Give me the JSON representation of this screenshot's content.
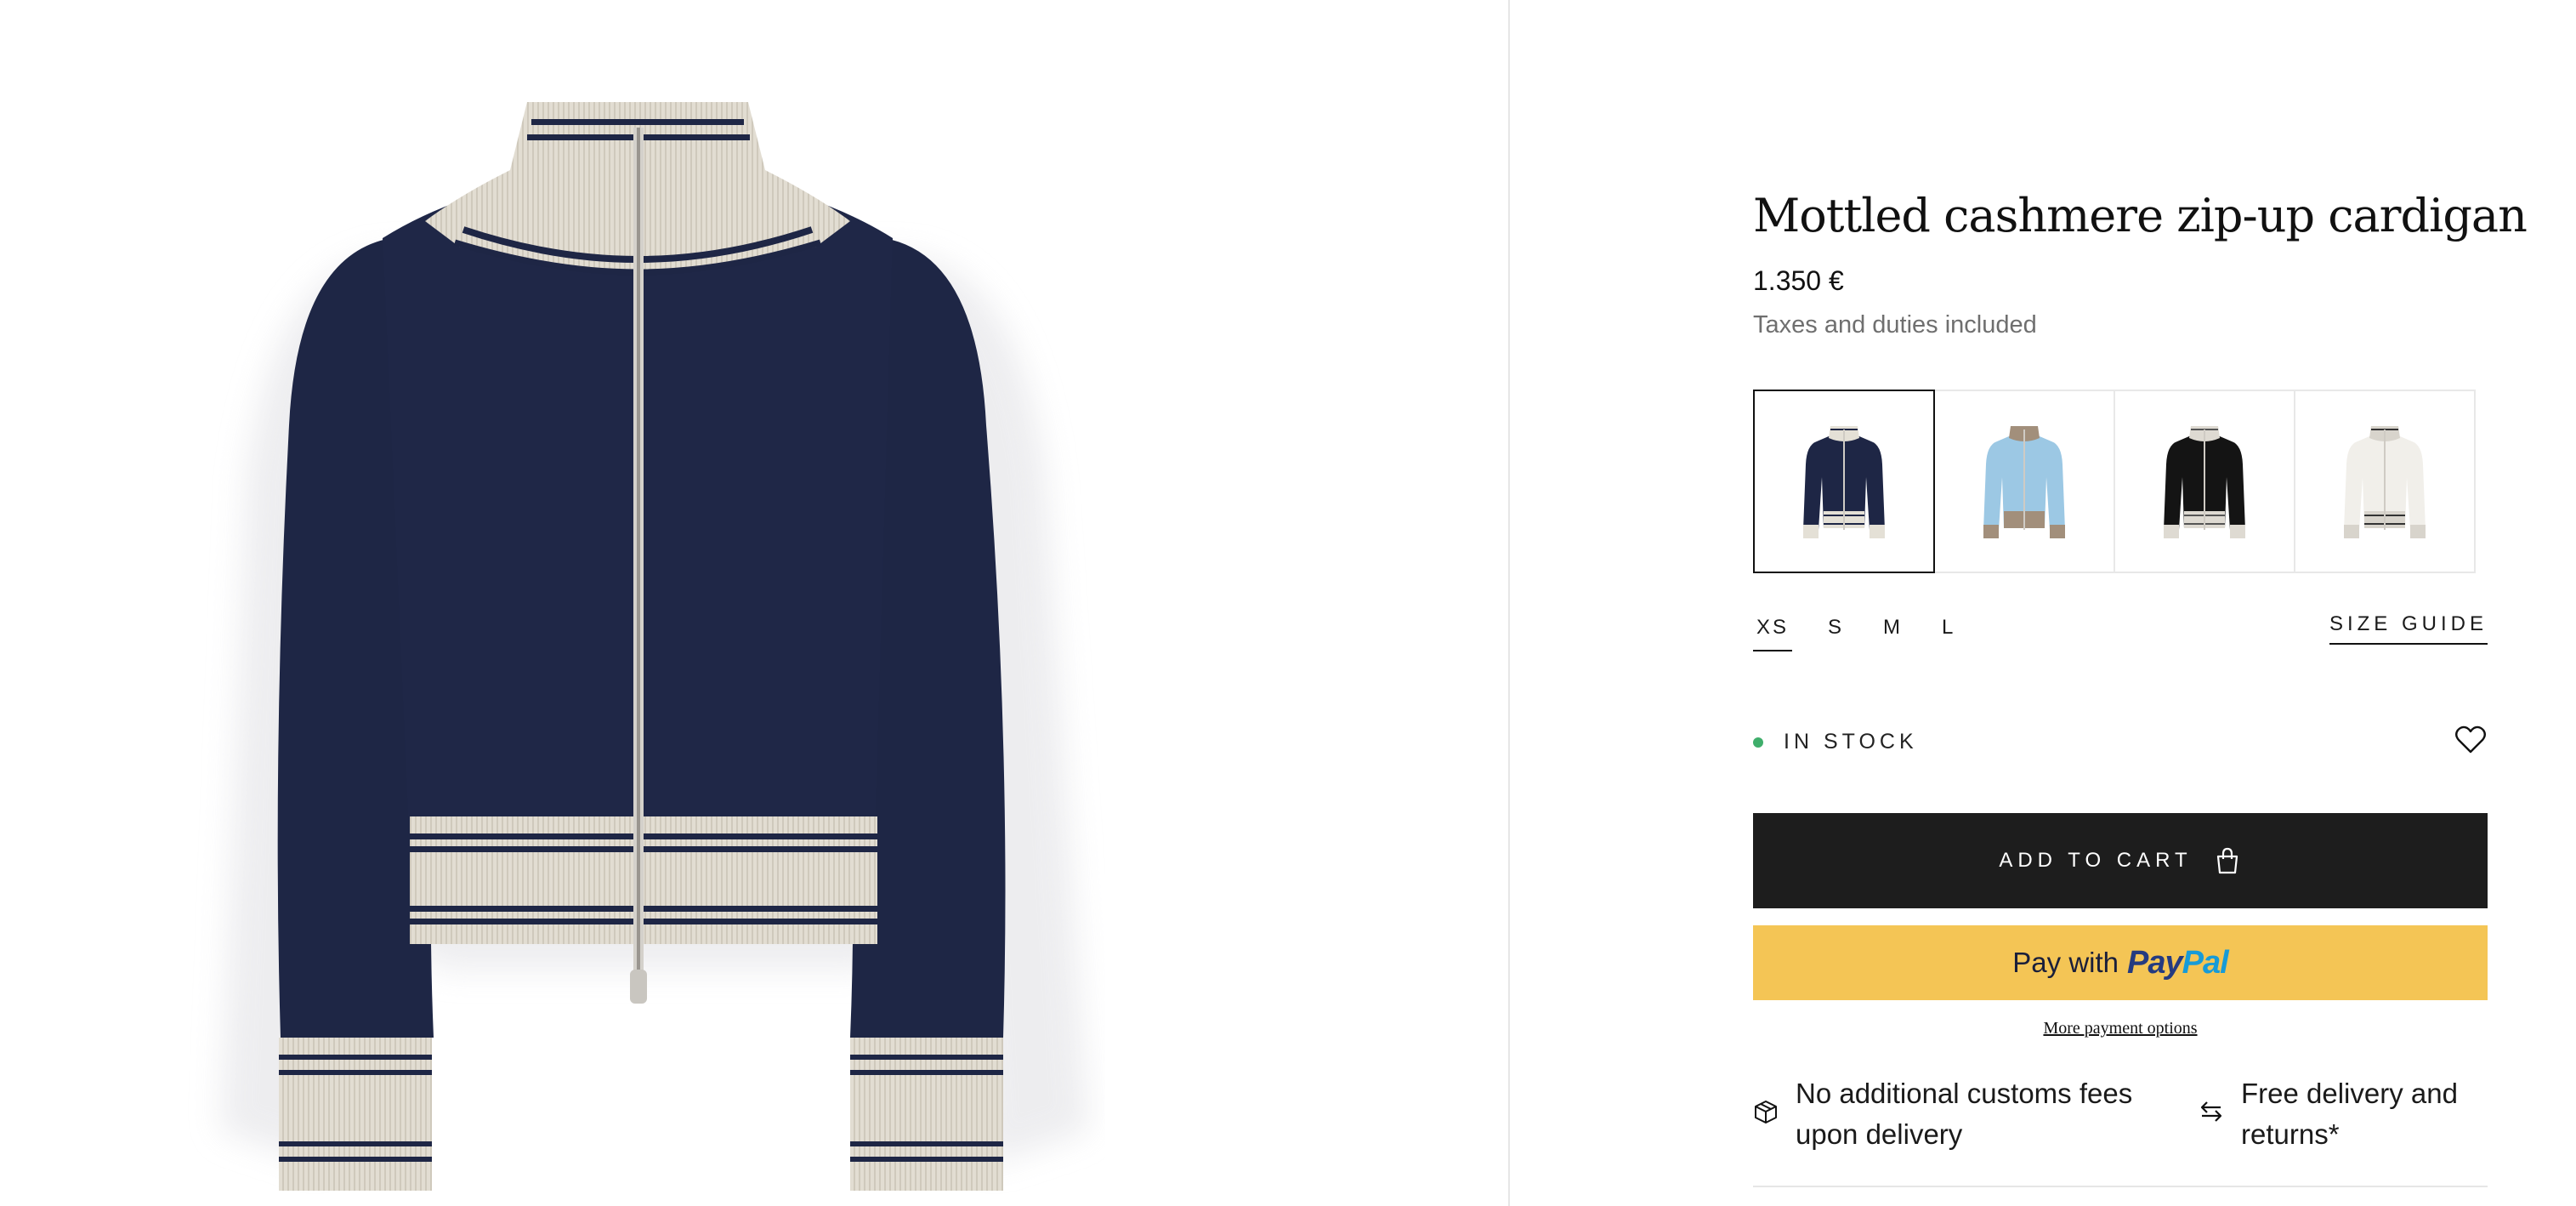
{
  "product": {
    "title": "Mottled cashmere zip-up cardigan",
    "price": "1.350 €",
    "tax_note": "Taxes and duties included",
    "image_icon": "cardigan-navy-image"
  },
  "swatches": [
    {
      "color_name": "navy",
      "body": "#1e2645",
      "trim": "#e4e0d6",
      "stripe": "#1e2645",
      "selected": true
    },
    {
      "color_name": "light-blue",
      "body": "#9cc8e4",
      "trim": "#a28f7b",
      "stripe": "#a28f7b",
      "selected": false
    },
    {
      "color_name": "black",
      "body": "#141414",
      "trim": "#dedad2",
      "stripe": "#555555",
      "selected": false
    },
    {
      "color_name": "ivory",
      "body": "#f1efea",
      "trim": "#d8d4cc",
      "stripe": "#333333",
      "selected": false
    }
  ],
  "sizes": {
    "options": [
      "XS",
      "S",
      "M",
      "L"
    ],
    "selected": "XS",
    "guide_label": "SIZE GUIDE"
  },
  "stock": {
    "label": "IN STOCK",
    "color": "#3fae6b"
  },
  "actions": {
    "add_to_cart_label": "ADD TO CART",
    "paypal_prefix": "Pay with",
    "paypal_brand_pay": "Pay",
    "paypal_brand_pal": "Pal",
    "more_payment_options": "More payment options"
  },
  "features": [
    {
      "icon": "box-icon",
      "text": "No additional customs fees upon delivery"
    },
    {
      "icon": "exchange-arrows-icon",
      "text": "Free delivery and returns*"
    }
  ],
  "colors": {
    "cart_button": "#1d1d1d",
    "paypal_button": "#f4c555",
    "paypal_dark": "#253b80",
    "paypal_light": "#179bd7"
  }
}
